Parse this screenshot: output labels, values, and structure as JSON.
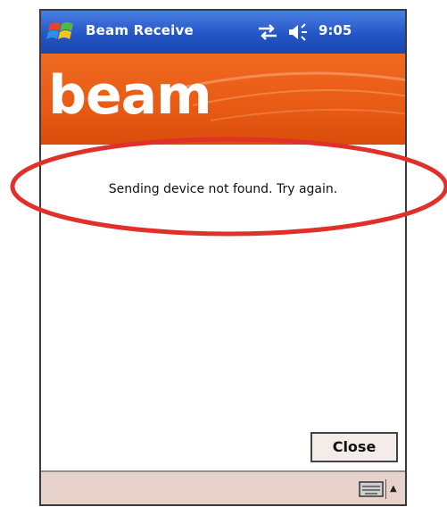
{
  "titlebar": {
    "app_title": "Beam Receive",
    "clock": "9:05",
    "icons": [
      "windows-flag-icon",
      "connectivity-icon",
      "volume-icon"
    ]
  },
  "banner": {
    "title": "beam"
  },
  "content": {
    "message": "Sending device not found. Try again."
  },
  "actions": {
    "close_label": "Close"
  },
  "bottombar": {
    "icons": [
      "keyboard-icon",
      "sip-menu-arrow-icon"
    ],
    "arrow_glyph": "▲"
  },
  "colors": {
    "titlebar_blue": "#2456c7",
    "banner_orange": "#e85a14",
    "bottombar": "#e7d3cc",
    "annotation_red": "#e0302a"
  }
}
